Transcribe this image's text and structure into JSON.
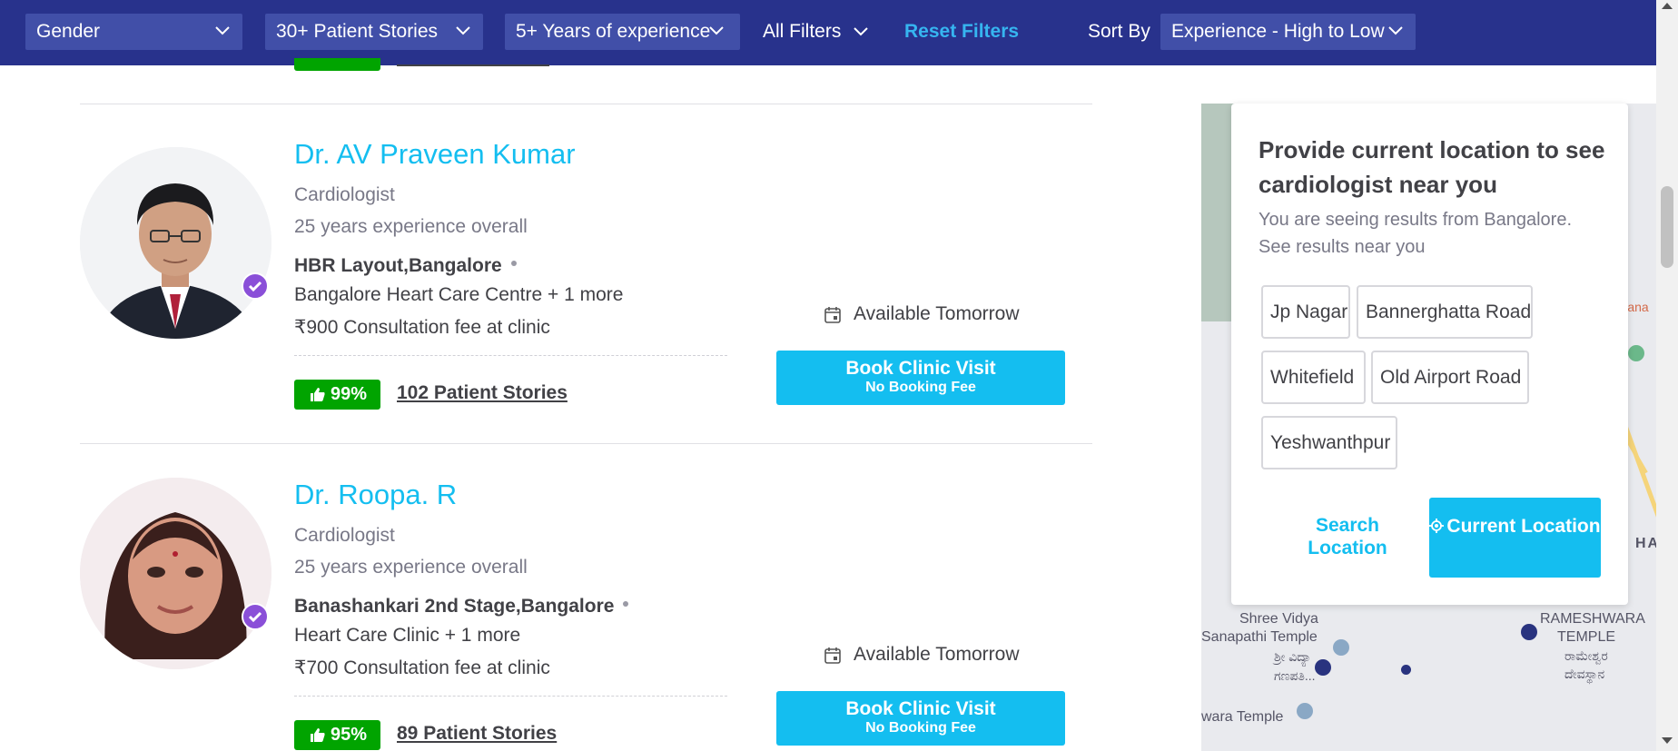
{
  "filters": {
    "gender": "Gender",
    "stories": "30+ Patient Stories",
    "experience": "5+ Years of experience",
    "all_filters": "All Filters",
    "reset": "Reset Filters",
    "sort_by_label": "Sort By",
    "sort_value": "Experience - High to Low"
  },
  "doctors": [
    {
      "name": "Dr. AV Praveen Kumar",
      "specialty": "Cardiologist",
      "experience": "25 years experience overall",
      "locality": "HBR Layout,Bangalore",
      "clinic": "Bangalore Heart Care Centre + 1 more",
      "fee": "₹900 Consultation fee at clinic",
      "rating": "99%",
      "stories": "102 Patient Stories",
      "availability": "Available Tomorrow",
      "book_label": "Book Clinic Visit",
      "book_sub": "No Booking Fee"
    },
    {
      "name": "Dr. Roopa. R",
      "specialty": "Cardiologist",
      "experience": "25 years experience overall",
      "locality": "Banashankari 2nd Stage,Bangalore",
      "clinic": "Heart Care Clinic + 1 more",
      "fee": "₹700 Consultation fee at clinic",
      "rating": "95%",
      "stories": "89 Patient Stories",
      "availability": "Available Tomorrow",
      "book_label": "Book Clinic Visit",
      "book_sub": "No Booking Fee"
    }
  ],
  "location_panel": {
    "title": "Provide current location to see cardiologist near you",
    "subtitle": "You are seeing results from Bangalore. See results near you",
    "chips": [
      "Jp Nagar",
      "Bannerghatta Road",
      "Whitefield",
      "Old Airport Road",
      "Yeshwanthpur"
    ],
    "search_location": "Search Location",
    "current_location": "Current Location"
  },
  "map": {
    "labels": [
      "Shree Vidya",
      "Sanapathi Temple",
      "ಶ್ರೀ ವಿದ್ಯಾ",
      "ಗಣಪತಿ...",
      "RAMESHWARA",
      "TEMPLE",
      "ರಾಮೇಶ್ವರ",
      "ದೇವಸ್ಥಾನ",
      "wara Temple",
      "HAL",
      "Kana"
    ]
  },
  "colors": {
    "header_bg": "#28328c",
    "accent": "#14bef0",
    "rating_green": "#01a400",
    "verified": "#8a4fd8"
  },
  "icons": [
    "chevron-down-icon",
    "calendar-icon",
    "thumbs-up-icon",
    "verified-check-icon",
    "location-target-icon"
  ]
}
